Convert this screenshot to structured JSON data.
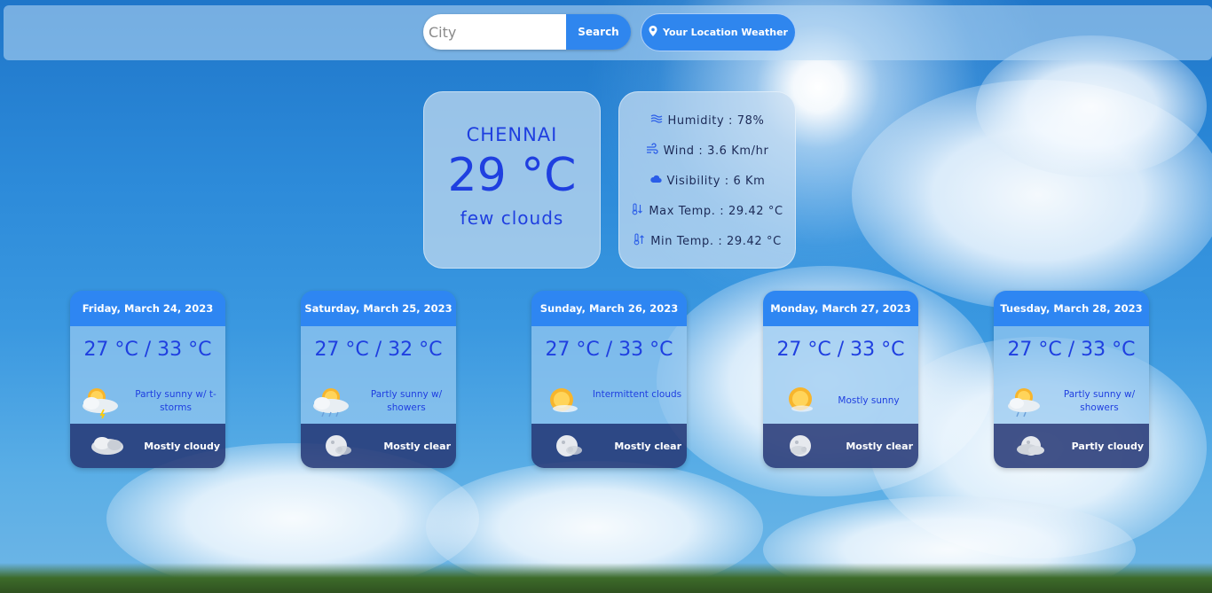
{
  "search": {
    "placeholder": "City",
    "value": "",
    "button_label": "Search"
  },
  "location_button": {
    "label": "Your Location Weather",
    "icon": "map-pin-icon"
  },
  "current": {
    "city": "CHENNAI",
    "temperature": "29 °C",
    "description": "few clouds"
  },
  "details": {
    "humidity": "Humidity : 78%",
    "wind": "Wind : 3.6 Km/hr",
    "visibility": "Visibility : 6 Km",
    "max_temp": "Max Temp. : 29.42 °C",
    "min_temp": "Min Temp. : 29.42 °C"
  },
  "colors": {
    "accent": "#2e86f2",
    "text_blue": "#1f3fe0",
    "night_band": "#283a78"
  },
  "forecast": [
    {
      "date": "Friday, March 24, 2023",
      "range": "27 °C / 33 °C",
      "day_text": "Partly sunny w/ t-storms",
      "day_icon": "partly-sunny-storm-icon",
      "night_text": "Mostly cloudy",
      "night_icon": "mostly-cloudy-night-icon"
    },
    {
      "date": "Saturday, March 25, 2023",
      "range": "27 °C / 32 °C",
      "day_text": "Partly sunny w/ showers",
      "day_icon": "partly-sunny-showers-icon",
      "night_text": "Mostly clear",
      "night_icon": "clear-night-icon"
    },
    {
      "date": "Sunday, March 26, 2023",
      "range": "27 °C / 33 °C",
      "day_text": "Intermittent clouds",
      "day_icon": "intermittent-clouds-icon",
      "night_text": "Mostly clear",
      "night_icon": "clear-night-icon"
    },
    {
      "date": "Monday, March 27, 2023",
      "range": "27 °C / 33 °C",
      "day_text": "Mostly sunny",
      "day_icon": "mostly-sunny-icon",
      "night_text": "Mostly clear",
      "night_icon": "clear-night-icon"
    },
    {
      "date": "Tuesday, March 28, 2023",
      "range": "27 °C / 33 °C",
      "day_text": "Partly sunny w/ showers",
      "day_icon": "partly-sunny-showers-icon",
      "night_text": "Partly cloudy",
      "night_icon": "partly-cloudy-night-icon"
    }
  ]
}
